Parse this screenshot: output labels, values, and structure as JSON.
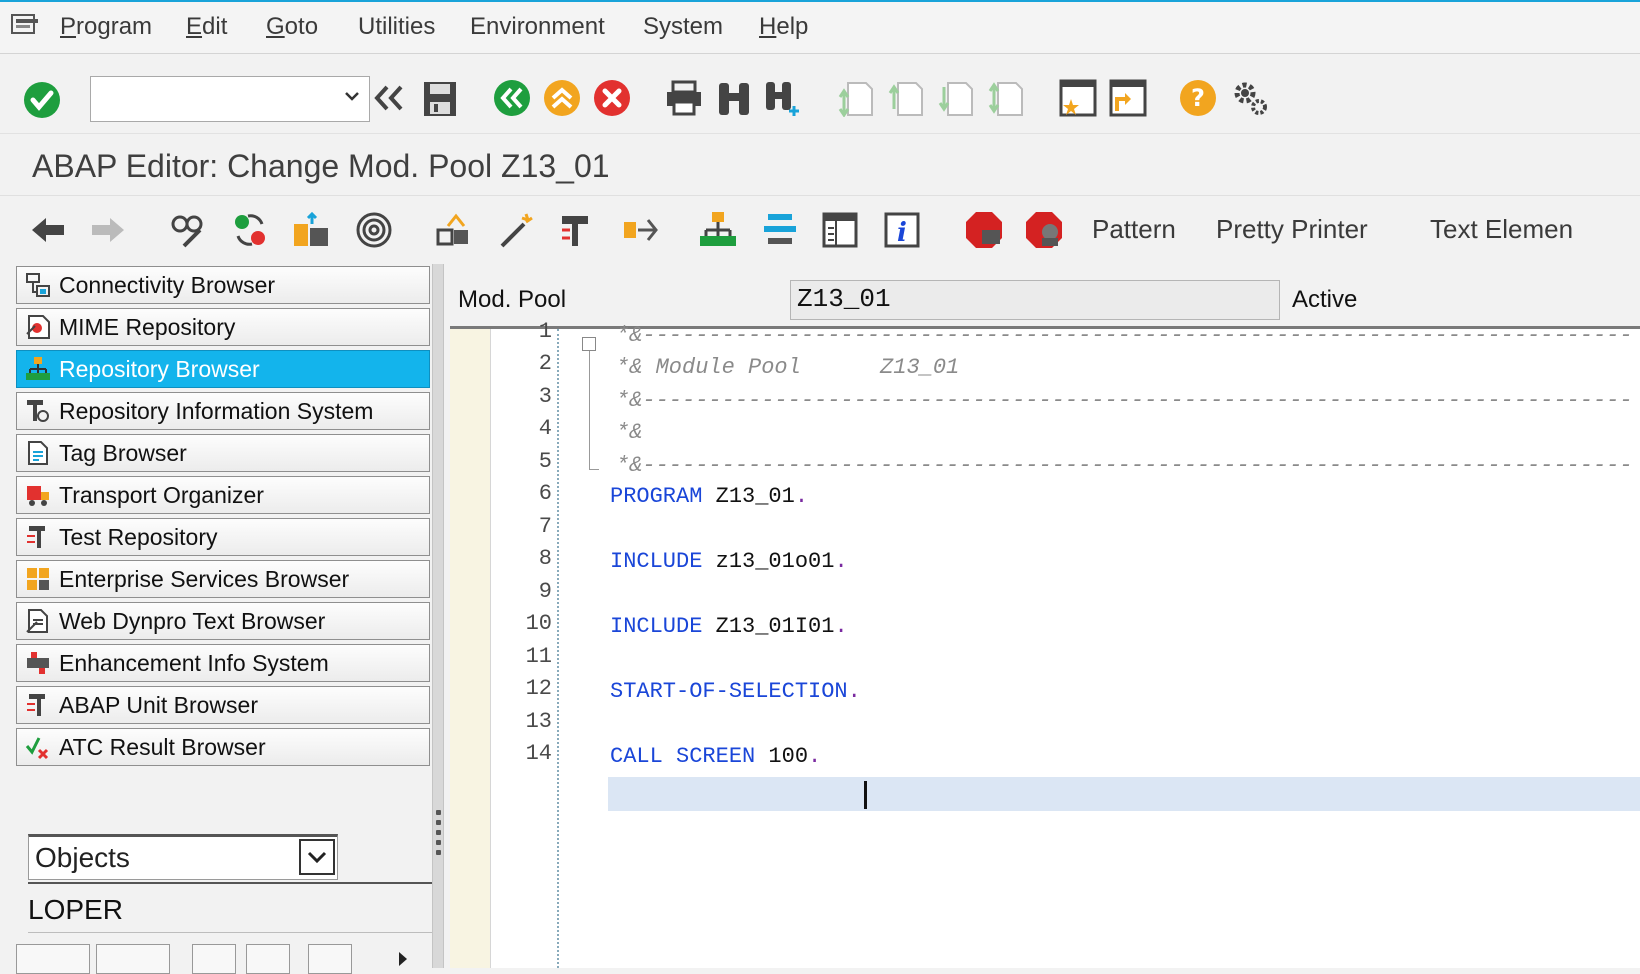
{
  "menu": [
    {
      "label": "Program",
      "underline": "P",
      "rest": "rogram"
    },
    {
      "label": "Edit",
      "underline": "E",
      "rest": "dit"
    },
    {
      "label": "Goto",
      "underline": "G",
      "rest": "oto"
    },
    {
      "label": "Utilities",
      "underline": "",
      "rest": "Utilities"
    },
    {
      "label": "Environment",
      "underline": "",
      "rest": "Environment"
    },
    {
      "label": "System",
      "underline": "",
      "rest": "System"
    },
    {
      "label": "Help",
      "underline": "H",
      "rest": "elp"
    }
  ],
  "command_field": {
    "value": "",
    "placeholder": ""
  },
  "title": "ABAP Editor: Change Mod. Pool Z13_01",
  "app_toolbar": {
    "pattern": "Pattern",
    "pretty_printer": "Pretty Printer",
    "text_elements": "Text Elemen"
  },
  "nav": [
    {
      "label": "Connectivity Browser",
      "active": false
    },
    {
      "label": "MIME Repository",
      "active": false
    },
    {
      "label": "Repository Browser",
      "active": true
    },
    {
      "label": "Repository Information System",
      "active": false
    },
    {
      "label": "Tag Browser",
      "active": false
    },
    {
      "label": "Transport Organizer",
      "active": false
    },
    {
      "label": "Test Repository",
      "active": false
    },
    {
      "label": "Enterprise Services Browser",
      "active": false
    },
    {
      "label": "Web Dynpro Text Browser",
      "active": false
    },
    {
      "label": "Enhancement Info System",
      "active": false
    },
    {
      "label": "ABAP Unit Browser",
      "active": false
    },
    {
      "label": "ATC Result Browser",
      "active": false
    }
  ],
  "objects_select": {
    "value": "Objects"
  },
  "user_field": {
    "value": "LOPER"
  },
  "header": {
    "type_label": "Mod. Pool",
    "name": "Z13_01",
    "status": "Active"
  },
  "code_lines": [
    {
      "n": "1",
      "comment": "*&---------------------------------------------------------------------------"
    },
    {
      "n": "2",
      "comment": "*& Module Pool      Z13_01"
    },
    {
      "n": "3",
      "comment": "*&---------------------------------------------------------------------------"
    },
    {
      "n": "4",
      "comment": "*&"
    },
    {
      "n": "5",
      "comment": "*&---------------------------------------------------------------------------"
    },
    {
      "n": "6",
      "kw": "PROGRAM",
      "id": " Z13_01",
      "dot": "."
    },
    {
      "n": "7"
    },
    {
      "n": "8",
      "kw": "INCLUDE",
      "id": " z13_01o01",
      "dot": "."
    },
    {
      "n": "9"
    },
    {
      "n": "10",
      "kw": "INCLUDE",
      "id": " Z13_01I01",
      "dot": "."
    },
    {
      "n": "11"
    },
    {
      "n": "12",
      "kw": "START-OF-SELECTION",
      "id": "",
      "dot": "."
    },
    {
      "n": "13"
    },
    {
      "n": "14",
      "kw": "CALL SCREEN",
      "id": " 100",
      "dot": "."
    }
  ],
  "colors": {
    "accent": "#19a3d9",
    "active_nav": "#13b4ec",
    "keyword": "#1a46d8",
    "comment": "#8a8a8a"
  }
}
